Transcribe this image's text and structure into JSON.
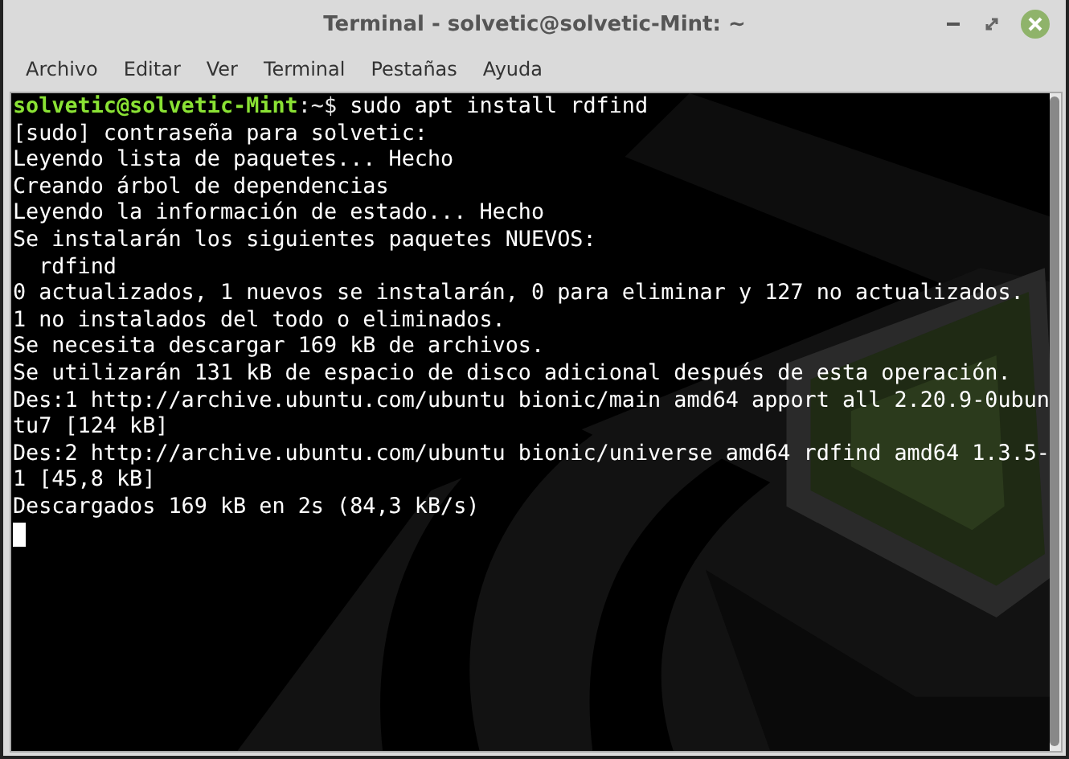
{
  "window": {
    "title": "Terminal - solvetic@solvetic-Mint: ~"
  },
  "menu": [
    "Archivo",
    "Editar",
    "Ver",
    "Terminal",
    "Pestañas",
    "Ayuda"
  ],
  "terminal": {
    "lines": [
      {
        "kind": "prompt",
        "user": "solvetic@solvetic-Mint",
        "path": ":~$",
        "command": " sudo apt install rdfind"
      },
      {
        "kind": "output",
        "text": "[sudo] contraseña para solvetic:"
      },
      {
        "kind": "output",
        "text": "Leyendo lista de paquetes... Hecho"
      },
      {
        "kind": "output",
        "text": "Creando árbol de dependencias"
      },
      {
        "kind": "output",
        "text": "Leyendo la información de estado... Hecho"
      },
      {
        "kind": "output",
        "text": "Se instalarán los siguientes paquetes NUEVOS:"
      },
      {
        "kind": "output",
        "text": "  rdfind"
      },
      {
        "kind": "output",
        "text": "0 actualizados, 1 nuevos se instalarán, 0 para eliminar y 127 no actualizados."
      },
      {
        "kind": "output",
        "text": "1 no instalados del todo o eliminados."
      },
      {
        "kind": "output",
        "text": "Se necesita descargar 169 kB de archivos."
      },
      {
        "kind": "output",
        "text": "Se utilizarán 131 kB de espacio de disco adicional después de esta operación."
      },
      {
        "kind": "output",
        "text": "Des:1 http://archive.ubuntu.com/ubuntu bionic/main amd64 apport all 2.20.9-0ubun"
      },
      {
        "kind": "output",
        "text": "tu7 [124 kB]"
      },
      {
        "kind": "output",
        "text": "Des:2 http://archive.ubuntu.com/ubuntu bionic/universe amd64 rdfind amd64 1.3.5-"
      },
      {
        "kind": "output",
        "text": "1 [45,8 kB]"
      },
      {
        "kind": "output",
        "text": "Descargados 169 kB en 2s (84,3 kB/s)"
      },
      {
        "kind": "cursor"
      }
    ]
  }
}
